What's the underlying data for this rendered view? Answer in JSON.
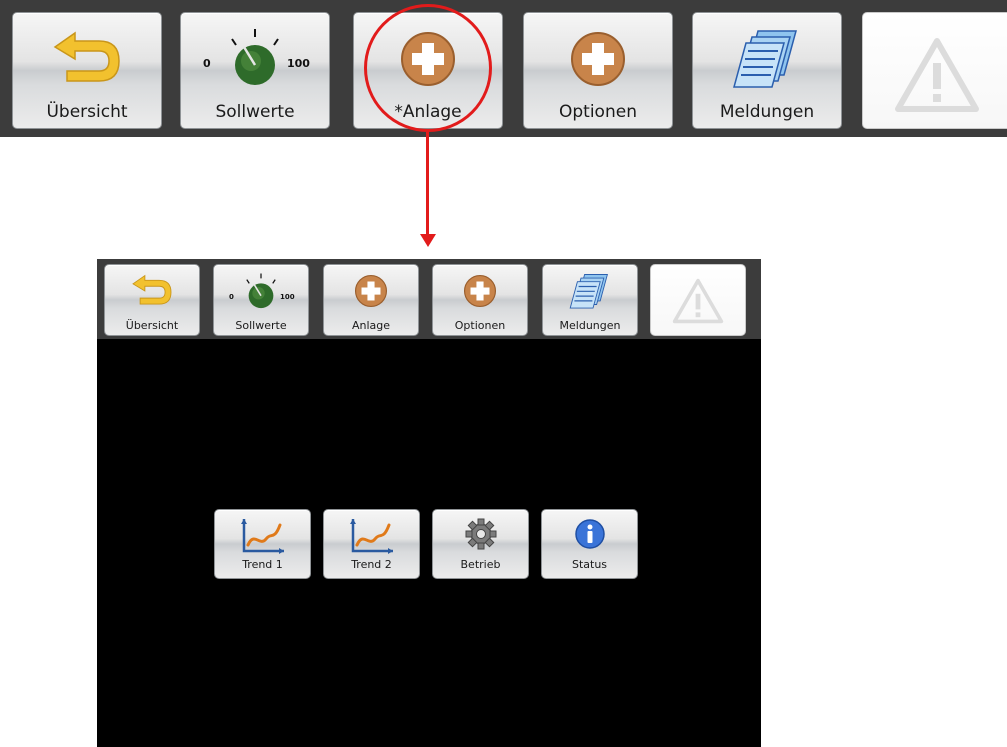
{
  "zoom_toolbar": {
    "buttons": [
      {
        "label": "Übersicht",
        "icon": "back-arrow-icon"
      },
      {
        "label": "Sollwerte",
        "icon": "knob-dial-icon",
        "scale_min": "0",
        "scale_max": "100"
      },
      {
        "label": "*Anlage",
        "icon": "plus-circle-icon"
      },
      {
        "label": "Optionen",
        "icon": "plus-circle-icon"
      },
      {
        "label": "Meldungen",
        "icon": "stacked-pages-icon"
      },
      {
        "label": "",
        "icon": "warning-triangle-icon"
      }
    ]
  },
  "screen": {
    "toolbar": {
      "buttons": [
        {
          "label": "Übersicht",
          "icon": "back-arrow-icon"
        },
        {
          "label": "Sollwerte",
          "icon": "knob-dial-icon",
          "scale_min": "0",
          "scale_max": "100"
        },
        {
          "label": "Anlage",
          "icon": "plus-circle-icon"
        },
        {
          "label": "Optionen",
          "icon": "plus-circle-icon"
        },
        {
          "label": "Meldungen",
          "icon": "stacked-pages-icon"
        },
        {
          "label": "",
          "icon": "warning-triangle-icon"
        }
      ]
    },
    "menu": {
      "buttons": [
        {
          "label": "Trend 1",
          "icon": "trend-chart-icon"
        },
        {
          "label": "Trend 2",
          "icon": "trend-chart-icon"
        },
        {
          "label": "Betrieb",
          "icon": "gear-icon"
        },
        {
          "label": "Status",
          "icon": "info-icon"
        }
      ]
    }
  },
  "colors": {
    "toolbar_bg": "#3c3c3c",
    "screen_bg": "#000000",
    "highlight": "#e21b1b",
    "plus_icon": "#c8844a",
    "arrow_icon": "#f2c12e",
    "knob": "#2e6b2a",
    "info_icon": "#3a74d8"
  }
}
